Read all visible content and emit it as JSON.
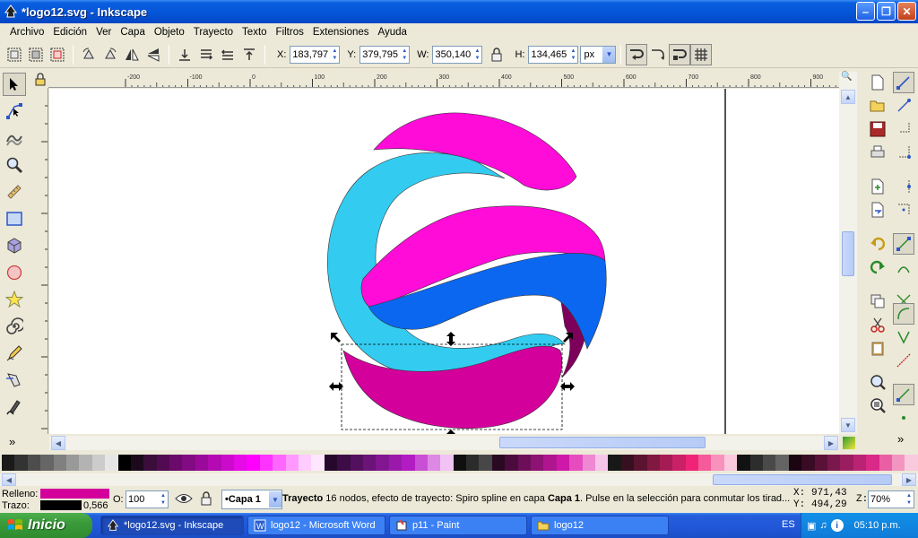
{
  "window": {
    "title": "*logo12.svg - Inkscape"
  },
  "menu": [
    "Archivo",
    "Edición",
    "Ver",
    "Capa",
    "Objeto",
    "Trayecto",
    "Texto",
    "Filtros",
    "Extensiones",
    "Ayuda"
  ],
  "toolbar": {
    "x_label": "X:",
    "x_value": "183,797",
    "y_label": "Y:",
    "y_value": "379,795",
    "w_label": "W:",
    "w_value": "350,140",
    "h_label": "H:",
    "h_value": "134,465",
    "unit": "px"
  },
  "ruler": {
    "ticks": [
      "-200",
      "-100",
      "0",
      "100",
      "200",
      "300",
      "400",
      "500",
      "600",
      "700",
      "800",
      "900"
    ]
  },
  "colors": {
    "cyan": "#33ccf0",
    "magenta": "#ff0cd8",
    "blue": "#0b67f0",
    "dark_magenta": "#c8009a",
    "purple": "#7d005a",
    "fill": "#d4009c",
    "stroke": "#000000"
  },
  "palette": [
    "#1a1a1a",
    "#333333",
    "#4d4d4d",
    "#666666",
    "#808080",
    "#999999",
    "#b3b3b3",
    "#cccccc",
    "#e6e6e6",
    "#000000",
    "#1c0a1c",
    "#3a0d3a",
    "#520a52",
    "#6a0a6a",
    "#820a82",
    "#9a0a9a",
    "#b30ab3",
    "#cc0acc",
    "#e60ae6",
    "#ff00ff",
    "#ff33ff",
    "#ff66ff",
    "#ff99ff",
    "#ffccff",
    "#ffe6ff",
    "#26082c",
    "#3d0b45",
    "#53105e",
    "#6b1378",
    "#821691",
    "#9a19aa",
    "#b21cc3",
    "#c94fd6",
    "#dd88e4",
    "#f0c3f2",
    "#101010",
    "#2b2b2b",
    "#474747",
    "#2a0a22",
    "#4b0c3d",
    "#6c0f58",
    "#8d1273",
    "#ae158e",
    "#cf18a9",
    "#e64cbf",
    "#ef88d3",
    "#f7c4e9",
    "#181818",
    "#36101e",
    "#5b1430",
    "#801842",
    "#a51c54",
    "#ca2066",
    "#ef2478",
    "#f55a9a",
    "#f991bd",
    "#fcc8de",
    "#121212",
    "#2d2d2d",
    "#494949",
    "#646464",
    "#1a0510",
    "#3a0b24",
    "#5a1138",
    "#7a174c",
    "#9a1d60",
    "#ba2374",
    "#da2988",
    "#ea5fa4",
    "#f395c1",
    "#f9cade"
  ],
  "fill_stroke": {
    "fill_label": "Relleno:",
    "stroke_label": "Trazo:",
    "stroke_width": "0,566",
    "opacity_label": "O:",
    "opacity_value": "100"
  },
  "layer": {
    "name": "•Capa 1"
  },
  "status": {
    "type": "Trayecto",
    "desc": " 16 nodos, efecto de trayecto: Spiro spline en capa ",
    "layer": "Capa 1",
    "rest": ". Pulse en la selección para conmutar los tirad..."
  },
  "coords": {
    "x_label": "X:",
    "x": "971,43",
    "y_label": "Y:",
    "y": "494,29",
    "zoom_label": "Z:",
    "zoom": "70%"
  },
  "taskbar": {
    "start": "Inicio",
    "tasks": [
      "*logo12.svg - Inkscape",
      "logo12 - Microsoft Word",
      "p11 - Paint",
      "logo12"
    ],
    "lang": "ES",
    "clock": "05:10 p.m."
  }
}
